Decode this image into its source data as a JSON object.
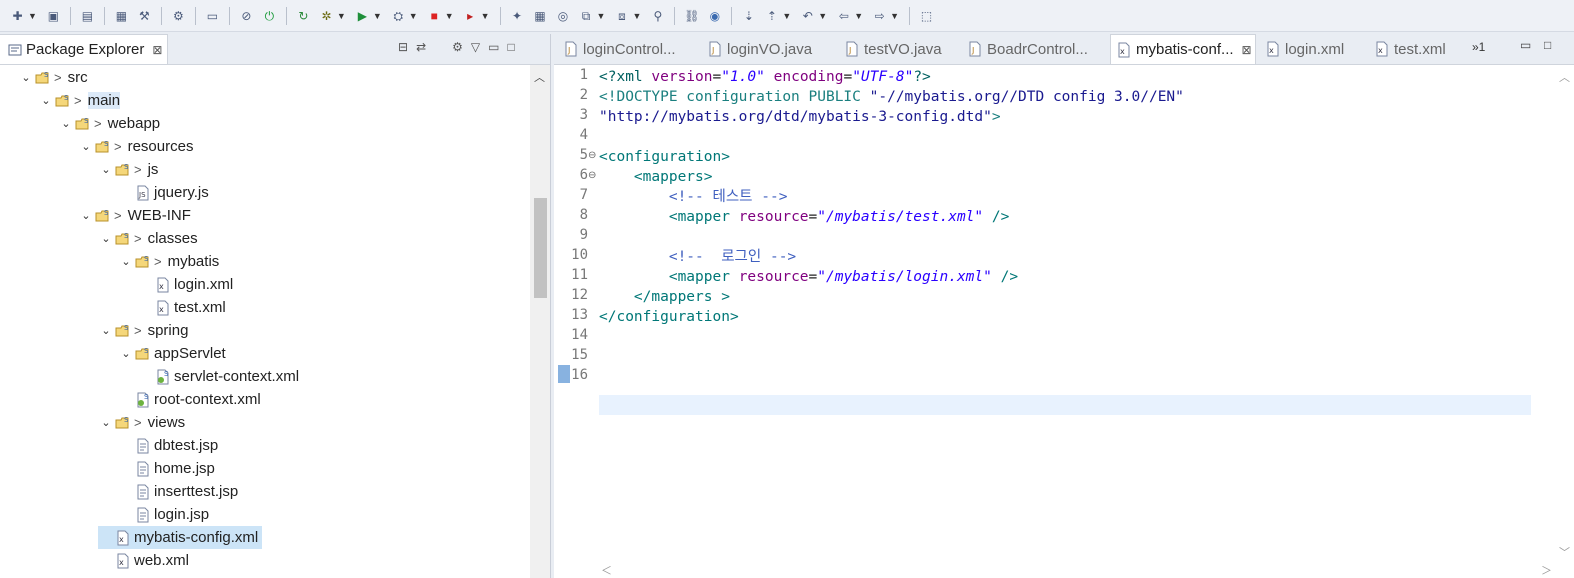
{
  "toolbar": {
    "buttons": [
      "new-icon",
      "save-icon",
      "save-all-icon",
      "binary-icon",
      "build-icon",
      "run-config-icon",
      "terminal-icon",
      "skip-breakpoints-icon",
      "stop-server-icon",
      "refresh-server-icon",
      "debug-icon",
      "run-icon",
      "run-external-icon",
      "stop-icon",
      "coverage-icon",
      "new-java-project-icon",
      "new-package-icon",
      "new-class-icon",
      "open-type-icon",
      "open-task-icon",
      "search-icon",
      "link-icon",
      "globe-icon",
      "next-annotation-icon",
      "previous-annotation-icon",
      "last-edit-icon",
      "back-icon",
      "forward-icon",
      "perspective-icon"
    ]
  },
  "explorer": {
    "title": "Package Explorer",
    "close_glyph": "⊠",
    "tree": [
      {
        "label": "src",
        "indent": 1,
        "expanded": true,
        "icon": "folder-icon",
        "prefix": ">"
      },
      {
        "label": "main",
        "indent": 2,
        "expanded": true,
        "icon": "folder-icon",
        "prefix": ">",
        "highlight": true
      },
      {
        "label": "webapp",
        "indent": 3,
        "expanded": true,
        "icon": "folder-icon",
        "prefix": ">"
      },
      {
        "label": "resources",
        "indent": 4,
        "expanded": true,
        "icon": "folder-icon",
        "prefix": ">"
      },
      {
        "label": "js",
        "indent": 5,
        "expanded": true,
        "icon": "folder-icon",
        "prefix": ">"
      },
      {
        "label": "jquery.js",
        "indent": 6,
        "icon": "js-file-icon"
      },
      {
        "label": "WEB-INF",
        "indent": 4,
        "expanded": true,
        "icon": "folder-icon",
        "prefix": ">"
      },
      {
        "label": "classes",
        "indent": 5,
        "expanded": true,
        "icon": "folder-icon",
        "prefix": ">"
      },
      {
        "label": "mybatis",
        "indent": 6,
        "expanded": true,
        "icon": "folder-icon",
        "prefix": ">"
      },
      {
        "label": "login.xml",
        "indent": 7,
        "icon": "xml-file-icon"
      },
      {
        "label": "test.xml",
        "indent": 7,
        "icon": "xml-file-icon"
      },
      {
        "label": "spring",
        "indent": 5,
        "expanded": true,
        "icon": "folder-icon",
        "prefix": ">"
      },
      {
        "label": "appServlet",
        "indent": 6,
        "expanded": true,
        "icon": "folder-icon"
      },
      {
        "label": "servlet-context.xml",
        "indent": 7,
        "icon": "spring-xml-icon"
      },
      {
        "label": "root-context.xml",
        "indent": 6,
        "icon": "spring-xml-icon"
      },
      {
        "label": "views",
        "indent": 5,
        "expanded": true,
        "icon": "folder-icon",
        "prefix": ">"
      },
      {
        "label": "dbtest.jsp",
        "indent": 6,
        "icon": "jsp-file-icon"
      },
      {
        "label": "home.jsp",
        "indent": 6,
        "icon": "jsp-file-icon"
      },
      {
        "label": "inserttest.jsp",
        "indent": 6,
        "icon": "jsp-file-icon"
      },
      {
        "label": "login.jsp",
        "indent": 6,
        "icon": "jsp-file-icon"
      },
      {
        "label": "mybatis-config.xml",
        "indent": 5,
        "icon": "xml-file-icon",
        "selected": true
      },
      {
        "label": "web.xml",
        "indent": 5,
        "icon": "xml-file-icon"
      }
    ]
  },
  "editor": {
    "tabs": [
      {
        "label": "loginControl...",
        "icon": "java-file-icon"
      },
      {
        "label": "loginVO.java",
        "icon": "java-file-icon"
      },
      {
        "label": "testVO.java",
        "icon": "java-file-icon"
      },
      {
        "label": "BoadrControl...",
        "icon": "java-file-icon"
      },
      {
        "label": "mybatis-conf...",
        "icon": "xml-file-icon",
        "active": true
      },
      {
        "label": "login.xml",
        "icon": "xml-file-icon"
      },
      {
        "label": "test.xml",
        "icon": "xml-file-icon"
      }
    ],
    "overflow_label": "»1",
    "line_numbers": [
      "1",
      "2",
      "3",
      "4",
      "5",
      "6",
      "7",
      "8",
      "9",
      "10",
      "11",
      "12",
      "13",
      "14",
      "15",
      "16"
    ],
    "folded_lines": [
      "5",
      "6"
    ],
    "lines": [
      [
        {
          "t": "<?xml ",
          "c": "tok-decl"
        },
        {
          "t": "version",
          "c": "tok-attr"
        },
        {
          "t": "=",
          "c": "tok-plain"
        },
        {
          "t": "\"1.0\"",
          "c": "tok-str"
        },
        {
          "t": " ",
          "c": "tok-plain"
        },
        {
          "t": "encoding",
          "c": "tok-attr"
        },
        {
          "t": "=",
          "c": "tok-plain"
        },
        {
          "t": "\"UTF-8\"",
          "c": "tok-str"
        },
        {
          "t": "?>",
          "c": "tok-decl"
        }
      ],
      [
        {
          "t": "<!DOCTYPE configuration PUBLIC ",
          "c": "tok-dt"
        },
        {
          "t": "\"-//mybatis.org//DTD config 3.0//EN\"",
          "c": "tok-dtstr"
        }
      ],
      [
        {
          "t": "\"http://mybatis.org/dtd/mybatis-3-config.dtd\"",
          "c": "tok-dtstr"
        },
        {
          "t": ">",
          "c": "tok-dt"
        }
      ],
      [],
      [
        {
          "t": "<configuration>",
          "c": "tok-tag"
        }
      ],
      [
        {
          "t": "    <mappers>",
          "c": "tok-tag"
        }
      ],
      [
        {
          "t": "        <!-- 테스트 -->",
          "c": "tok-cmt"
        }
      ],
      [
        {
          "t": "        <mapper ",
          "c": "tok-tag"
        },
        {
          "t": "resource",
          "c": "tok-attr"
        },
        {
          "t": "=",
          "c": "tok-plain"
        },
        {
          "t": "\"/mybatis/test.xml\"",
          "c": "tok-str"
        },
        {
          "t": " />",
          "c": "tok-tag"
        }
      ],
      [],
      [
        {
          "t": "        <!--  로그인 -->",
          "c": "tok-cmt"
        }
      ],
      [
        {
          "t": "        <mapper ",
          "c": "tok-tag"
        },
        {
          "t": "resource",
          "c": "tok-attr"
        },
        {
          "t": "=",
          "c": "tok-plain"
        },
        {
          "t": "\"/mybatis/login.xml\"",
          "c": "tok-str"
        },
        {
          "t": " />",
          "c": "tok-tag"
        }
      ],
      [
        {
          "t": "    </mappers >",
          "c": "tok-tag"
        }
      ],
      [
        {
          "t": "</configuration>",
          "c": "tok-tag"
        }
      ],
      [],
      [],
      []
    ]
  }
}
